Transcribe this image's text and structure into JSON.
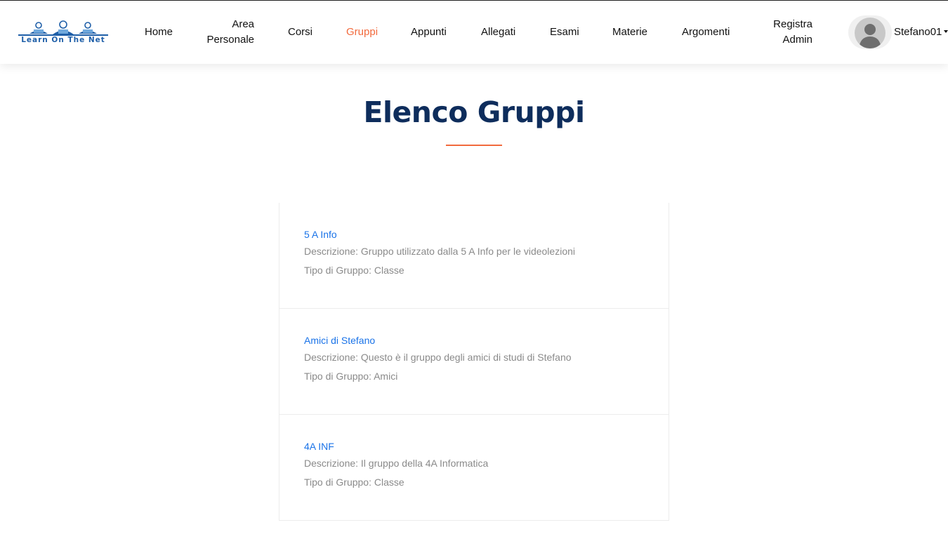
{
  "header": {
    "logo_text": "Learn On The Net",
    "nav": [
      {
        "label": "Home",
        "active": false
      },
      {
        "label": "Area Personale",
        "line1": "Area",
        "line2": "Personale",
        "active": false
      },
      {
        "label": "Corsi",
        "active": false
      },
      {
        "label": "Gruppi",
        "active": true
      },
      {
        "label": "Appunti",
        "active": false
      },
      {
        "label": "Allegati",
        "active": false
      },
      {
        "label": "Esami",
        "active": false
      },
      {
        "label": "Materie",
        "active": false
      },
      {
        "label": "Argomenti",
        "active": false
      },
      {
        "label": "Registra Admin",
        "line1": "Registra",
        "line2": "Admin",
        "active": false
      }
    ],
    "user": {
      "name": "Stefano01",
      "avatar_icon": "user-avatar-icon"
    }
  },
  "main": {
    "title": "Elenco Gruppi",
    "groups": [
      {
        "name": "5 A Info",
        "description": "Descrizione: Gruppo utilizzato dalla 5 A Info per le videolezioni",
        "type": "Tipo di Gruppo: Classe"
      },
      {
        "name": "Amici di Stefano",
        "description": "Descrizione: Questo è il gruppo degli amici di studi di Stefano",
        "type": "Tipo di Gruppo: Amici"
      },
      {
        "name": "4A INF",
        "description": "Descrizione: Il gruppo della 4A Informatica",
        "type": "Tipo di Gruppo: Classe"
      }
    ]
  },
  "colors": {
    "accent": "#f26a3d",
    "title": "#0e2d5c",
    "link": "#1a73e8",
    "muted_text": "#8a8a8a"
  }
}
